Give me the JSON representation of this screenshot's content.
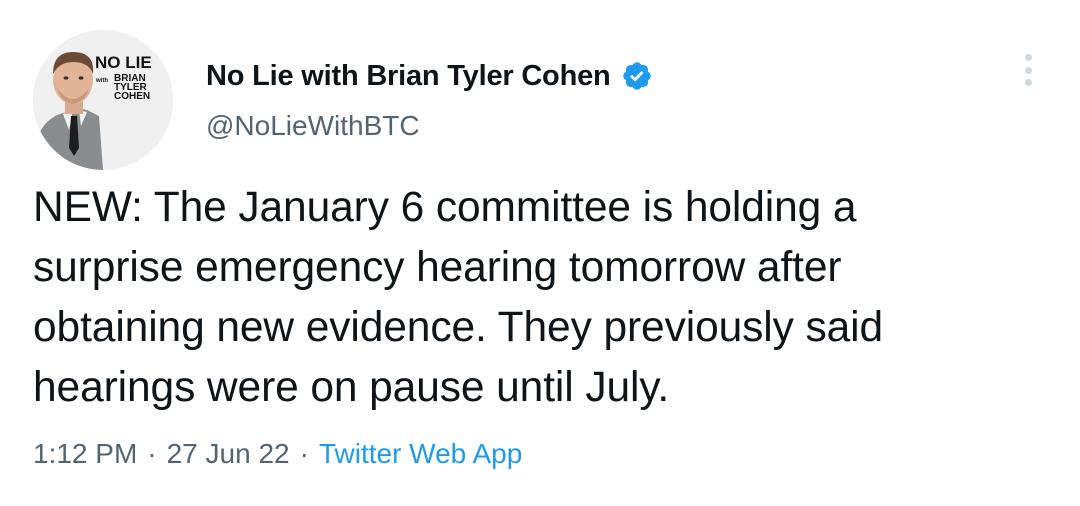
{
  "author": {
    "display_name": "No Lie with Brian Tyler Cohen",
    "handle": "@NoLieWithBTC",
    "verified": true,
    "avatar_logo_lines": [
      "NO LIE",
      "with",
      "BRIAN",
      "TYLER",
      "COHEN"
    ]
  },
  "tweet": {
    "text": "NEW: The January 6 committee is holding a\nsurprise emergency hearing tomorrow after\nobtaining new evidence. They previously said\nhearings were on pause until July."
  },
  "meta": {
    "time": "1:12 PM",
    "separator": "·",
    "date": "27 Jun 22",
    "source": "Twitter Web App"
  },
  "icons": {
    "verified": "verified-badge-icon",
    "more": "more-options-icon"
  },
  "colors": {
    "text_primary": "#0f1419",
    "text_secondary": "#536471",
    "link": "#1d9bf0",
    "verified_badge": "#1d9bf0"
  }
}
